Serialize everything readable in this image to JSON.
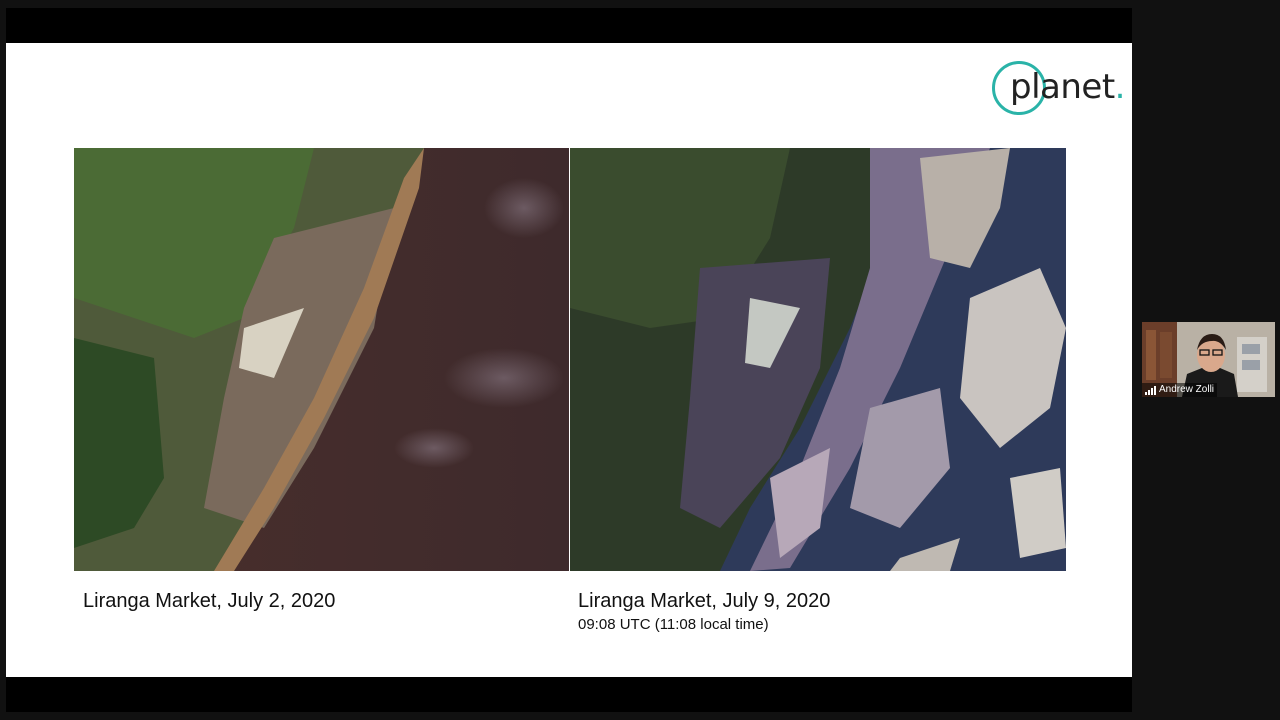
{
  "slide": {
    "logo_text": "planet",
    "logo_dot": ".",
    "brand_color": "#2ab3a8"
  },
  "images": {
    "left": {
      "caption": "Liranga Market, July 2, 2020"
    },
    "right": {
      "caption": "Liranga Market, July 9, 2020",
      "subcaption": "09:08 UTC (11:08 local time)"
    }
  },
  "participant": {
    "name": "Andrew Zolli",
    "icon": "signal-bars-icon"
  }
}
